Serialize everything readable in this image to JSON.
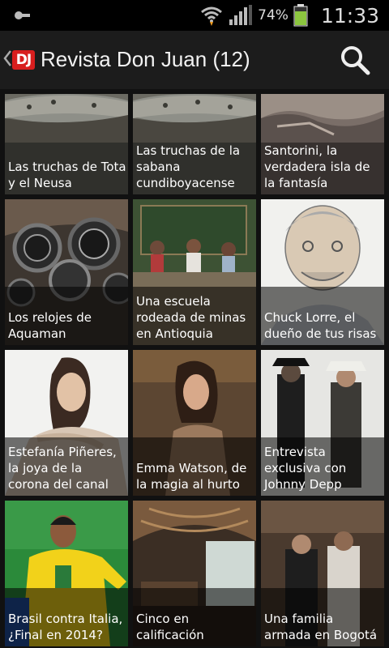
{
  "status": {
    "battery_pct": "74%",
    "time": "11:33",
    "battery_color": "#8cc63f"
  },
  "toolbar": {
    "title": "Revista Don Juan (12)",
    "logo_text": "DJ",
    "logo_color": "#d81e1e",
    "icons": [
      "chevron-left-icon",
      "search-icon"
    ]
  },
  "articles": [
    {
      "title": "Las truchas de Tota y el Neusa",
      "thumb": "fish"
    },
    {
      "title": "Las truchas de la sabana cundiboyacense",
      "thumb": "fish"
    },
    {
      "title": "Santorini, la verdadera isla de la fantasía",
      "thumb": "rocks"
    },
    {
      "title": "Los relojes de Aquaman",
      "thumb": "watches"
    },
    {
      "title": "Una escuela rodeada de minas en Antioquia",
      "thumb": "classroom"
    },
    {
      "title": "Chuck Lorre, el dueño de tus risas",
      "thumb": "portrait-sketch"
    },
    {
      "title": "Estefanía Piñeres, la joya de la corona del canal",
      "thumb": "woman-white"
    },
    {
      "title": "Emma Watson, de la magia al hurto",
      "thumb": "woman-dark"
    },
    {
      "title": "Entrevista exclusiva con Johnny Depp",
      "thumb": "cowboys"
    },
    {
      "title": "Brasil contra Italia, ¿Final en 2014?",
      "thumb": "footballer"
    },
    {
      "title": "Cinco en calificación",
      "thumb": "restaurant"
    },
    {
      "title": "Una familia armada en Bogotá",
      "thumb": "two-men"
    }
  ]
}
